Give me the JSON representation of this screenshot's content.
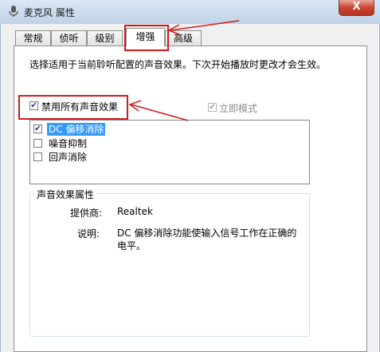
{
  "window": {
    "title": "麦克风 属性",
    "close_label": "X"
  },
  "tabs": [
    {
      "label": "常规"
    },
    {
      "label": "侦听"
    },
    {
      "label": "级别"
    },
    {
      "label": "增强",
      "active": true
    },
    {
      "label": "高级"
    }
  ],
  "enhancements": {
    "description": "选择适用于当前聆听配置的声音效果。下次开始播放时更改才会生效。",
    "disable_all_label": "禁用所有声音效果",
    "disable_all_checked": true,
    "immediate_mode_label": "立即模式",
    "immediate_mode_checked": true,
    "immediate_mode_disabled": true,
    "effects": [
      {
        "label": "DC 偏移消除",
        "checked": true,
        "selected": true
      },
      {
        "label": "噪音抑制",
        "checked": false
      },
      {
        "label": "回声消除",
        "checked": false
      }
    ]
  },
  "properties": {
    "title": "声音效果属性",
    "provider_label": "提供商:",
    "provider_value": "Realtek",
    "description_label": "说明:",
    "description_value": "DC 偏移消除功能使输入信号工作在正确的电平。"
  },
  "colors": {
    "annotation_red": "#d21b1b",
    "selection_blue": "#3399ff"
  }
}
